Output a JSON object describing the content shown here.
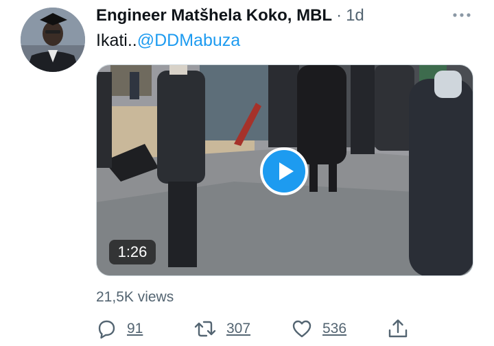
{
  "tweet": {
    "author_name": "Engineer Matšhela Koko, MBL",
    "separator": "·",
    "timestamp": "1d",
    "text_plain": "Ikati..",
    "text_mention": "@DDMabuza",
    "video_duration": "1:26",
    "views": "21,5K views"
  },
  "actions": {
    "reply_count": "91",
    "retweet_count": "307",
    "like_count": "536"
  },
  "icons": {
    "more": "more-horizontal-icon",
    "play": "play-icon",
    "reply": "reply-icon",
    "retweet": "retweet-icon",
    "like": "heart-icon",
    "share": "share-icon"
  },
  "colors": {
    "accent": "#1d9bf0",
    "text": "#0f1419",
    "secondary": "#536471"
  }
}
